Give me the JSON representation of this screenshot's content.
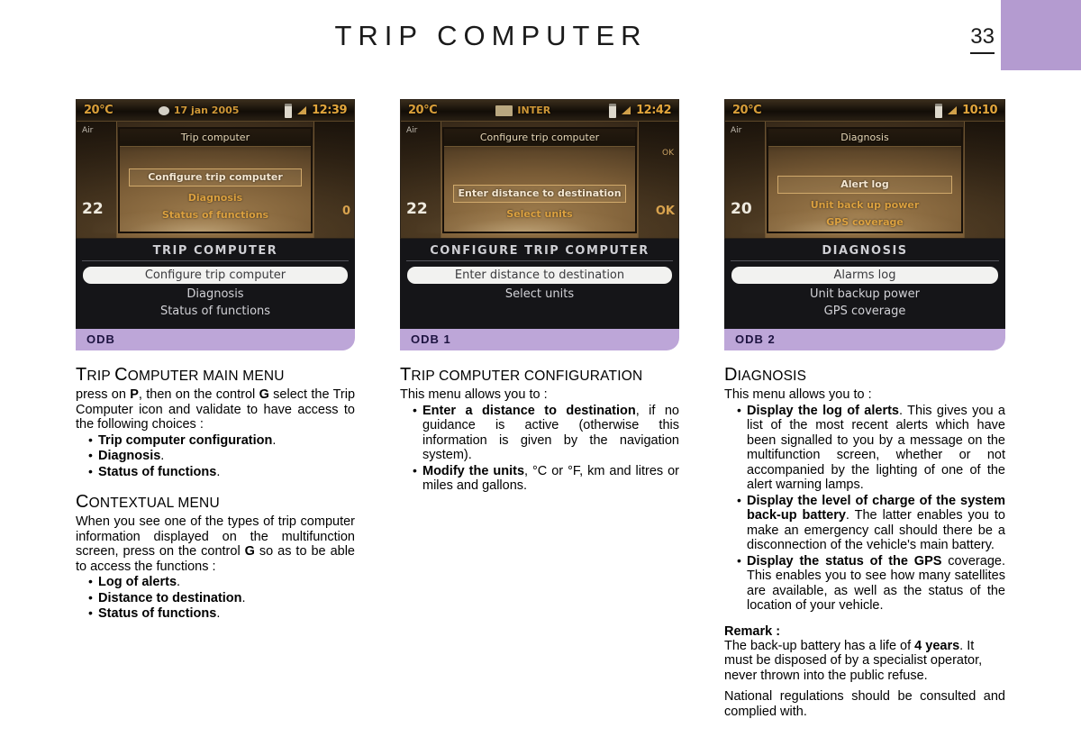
{
  "header": {
    "title": "TRIP COMPUTER",
    "page_number": "33",
    "corner_color": "#b49bd0"
  },
  "columns": [
    {
      "photo": {
        "status_bar": {
          "temperature": "20°C",
          "middle_text": "17 jan 2005",
          "middle_icon": "disc-icon",
          "battery_icon": "battery-icon",
          "signal_icon": "signal-icon",
          "clock": "12:39"
        },
        "left_gauge_top": "Air",
        "left_gauge_value": "22",
        "right_gauge_top": "",
        "right_gauge_value": "0",
        "dialog_title": "Trip computer",
        "menu_items": [
          {
            "label": "Configure trip computer",
            "selected": true
          },
          {
            "label": "Diagnosis",
            "selected": false
          },
          {
            "label": "Status of functions",
            "selected": false
          }
        ]
      },
      "lcd": {
        "title": "TRIP COMPUTER",
        "items": [
          {
            "label": "Configure trip computer",
            "selected": true
          },
          {
            "label": "Diagnosis",
            "selected": false
          },
          {
            "label": "Status of functions",
            "selected": false
          }
        ],
        "odb_label": "ODB"
      },
      "sections": [
        {
          "heading_parts": [
            {
              "text": "T",
              "style": "cap"
            },
            {
              "text": "RIP ",
              "style": "sm"
            },
            {
              "text": "C",
              "style": "cap"
            },
            {
              "text": "OMPUTER MAIN MENU",
              "style": "sm"
            }
          ],
          "paragraph_html": "press on <b>P</b>, then on the control <b>G</b> select the Trip Computer icon and validate to have access to the following choices :",
          "bullets_html": [
            "<b>Trip computer configuration</b>.",
            "<b>Diagnosis</b>.",
            "<b>Status of functions</b>."
          ]
        },
        {
          "heading_parts": [
            {
              "text": "C",
              "style": "cap"
            },
            {
              "text": "ONTEXTUAL MENU",
              "style": "sm"
            }
          ],
          "paragraph_html": "When you see one of the types of trip computer information displayed on the multifunction screen, press on the control <b>G</b> so as to be able to access the functions :",
          "bullets_html": [
            "<b>Log of alerts</b>.",
            "<b>Distance to destination</b>.",
            "<b>Status of functions</b>."
          ]
        }
      ]
    },
    {
      "photo": {
        "status_bar": {
          "temperature": "20°C",
          "middle_text": "INTER",
          "middle_icon": "chip-icon",
          "battery_icon": "battery-icon",
          "signal_icon": "signal-icon",
          "clock": "12:42"
        },
        "left_gauge_top": "Air",
        "left_gauge_value": "22",
        "right_gauge_top": "OK",
        "right_gauge_value": "OK",
        "dialog_title": "Configure trip computer",
        "menu_items": [
          {
            "label": "Enter distance to destination",
            "selected": true
          },
          {
            "label": "Select units",
            "selected": false
          }
        ]
      },
      "lcd": {
        "title": "CONFIGURE TRIP COMPUTER",
        "items": [
          {
            "label": "Enter distance to destination",
            "selected": true
          },
          {
            "label": "Select units",
            "selected": false
          }
        ],
        "odb_label": "ODB 1"
      },
      "sections": [
        {
          "heading_parts": [
            {
              "text": "T",
              "style": "cap"
            },
            {
              "text": "RIP COMPUTER CONFIGURATION",
              "style": "sm"
            }
          ],
          "paragraph_html": "This menu allows you to :",
          "bullets_html": [
            "<b>Enter a distance to destination</b>, if no guidance is active (otherwise this information is given by the navigation system).",
            "<b>Modify the units</b>, °C or °F, km and litres or miles and gallons."
          ]
        }
      ]
    },
    {
      "photo": {
        "status_bar": {
          "temperature": "20°C",
          "middle_text": "",
          "middle_icon": "",
          "battery_icon": "battery-icon",
          "signal_icon": "signal-icon",
          "clock": "10:10"
        },
        "left_gauge_top": "Air",
        "left_gauge_value": "20",
        "right_gauge_top": "",
        "right_gauge_value": "",
        "dialog_title": "Diagnosis",
        "menu_items": [
          {
            "label": "Alert log",
            "selected": true
          },
          {
            "label": "Unit back up power",
            "selected": false
          },
          {
            "label": "GPS coverage",
            "selected": false
          }
        ]
      },
      "lcd": {
        "title": "DIAGNOSIS",
        "items": [
          {
            "label": "Alarms log",
            "selected": true
          },
          {
            "label": "Unit backup power",
            "selected": false
          },
          {
            "label": "GPS coverage",
            "selected": false
          }
        ],
        "odb_label": "ODB 2"
      },
      "sections": [
        {
          "heading_parts": [
            {
              "text": "D",
              "style": "cap"
            },
            {
              "text": "IAGNOSIS",
              "style": "sm"
            }
          ],
          "paragraph_html": "This menu allows you to :",
          "bullets_html": [
            "<b>Display the log of alerts</b>. This gives you a list of the most recent alerts which have been signalled to you by a message on the multifunction screen, whether or not accompanied by the lighting of one of the alert warning lamps.",
            "<b>Display the level of charge of the system back-up battery</b>. The latter enables you to make an emergency call should there be a disconnection of the vehicle's main battery.",
            "<b>Display the status of the GPS</b> coverage. This enables you to see how many satellites are available, as well as the status of the location of your vehicle."
          ],
          "remark_heading": "Remark :",
          "remark_paragraphs_html": [
            "The back-up battery has a life of <b>4 years</b>. It must be disposed of by a specialist operator, never thrown into the public refuse.",
            "National regulations should be consulted and complied with."
          ]
        }
      ]
    }
  ]
}
